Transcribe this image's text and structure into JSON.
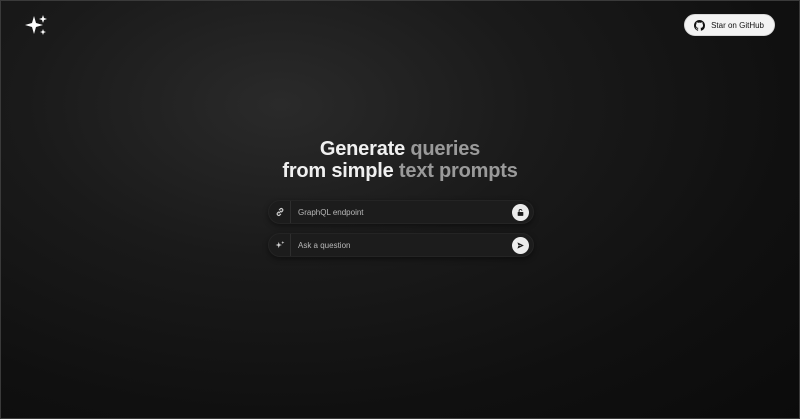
{
  "header": {
    "logo_icon": "sparkles-icon",
    "github_button": {
      "label": "Star on GitHub",
      "icon": "github-icon"
    }
  },
  "hero": {
    "line1_bright": "Generate ",
    "line1_dim": "queries",
    "line2_bright": "from simple ",
    "line2_dim": "text prompts"
  },
  "endpoint_field": {
    "icon": "link-icon",
    "value": "",
    "placeholder": "GraphQL endpoint",
    "action_icon": "lock-open-icon"
  },
  "question_field": {
    "icon": "sparkles-icon",
    "value": "",
    "placeholder": "Ask a question",
    "action_icon": "send-icon"
  },
  "colors": {
    "background": "#121212",
    "hero_bright": "#f0f0f0",
    "hero_dim": "#9a9a9a",
    "field_bg": "#1c1c1c",
    "button_bg": "#f3f3f3"
  }
}
